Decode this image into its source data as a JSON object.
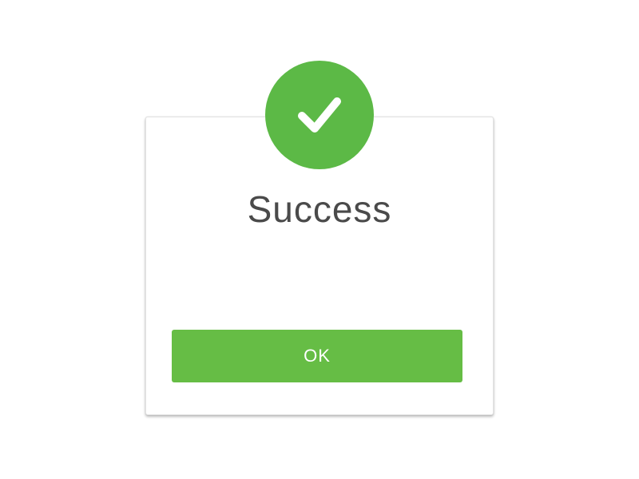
{
  "dialog": {
    "title": "Success",
    "message": "",
    "ok_label": "OK",
    "icon": "checkmark-icon"
  },
  "colors": {
    "accent": "#5cb946",
    "button": "#66bd45",
    "title_text": "#4a4a4a",
    "button_text": "#ffffff",
    "background": "#ffffff"
  }
}
